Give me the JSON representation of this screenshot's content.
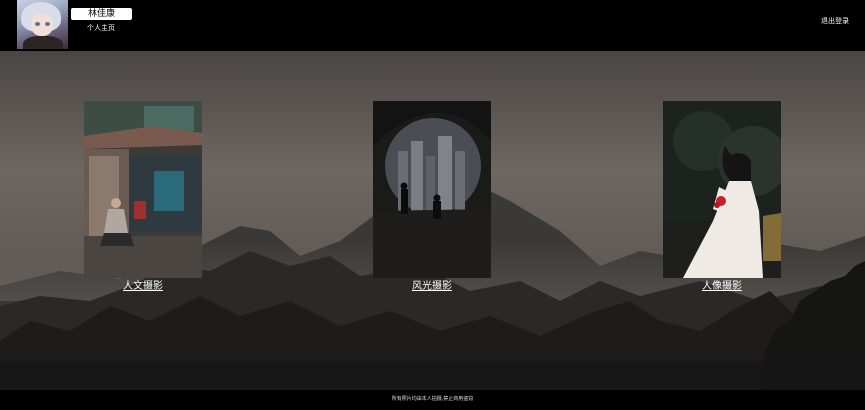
{
  "header": {
    "username": "林佳康",
    "profile_link": "个人主页",
    "logout": "退出登录"
  },
  "gallery": [
    {
      "label": "人文摄影"
    },
    {
      "label": "风光摄影"
    },
    {
      "label": "人像摄影"
    }
  ],
  "footer": {
    "text": "所有照片均由本人拍摄,禁止商用盗窃"
  },
  "colors": {
    "header_bg": "#000000",
    "sky": "#6e6560",
    "mountains": "#1f1e1d"
  }
}
